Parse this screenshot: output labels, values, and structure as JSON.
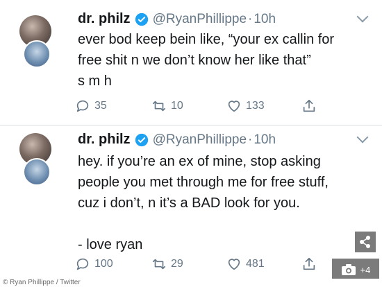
{
  "tweets": [
    {
      "name": "dr. philz",
      "handle": "@RyanPhillippe",
      "separator": "·",
      "time": "10h",
      "lines": [
        "ever bod keep bein like, “your ex callin for",
        "free shit n we don’t know her like that”",
        "s m h"
      ],
      "replies": "35",
      "retweets": "10",
      "likes": "133"
    },
    {
      "name": "dr. philz",
      "handle": "@RyanPhillippe",
      "separator": "·",
      "time": "10h",
      "lines": [
        "hey. if you’re an ex of mine, stop asking",
        "people you met through me for free stuff,",
        "cuz i don’t, n it’s a BAD look for you.",
        "",
        "- love ryan"
      ],
      "replies": "100",
      "retweets": "29",
      "likes": "481"
    }
  ],
  "overlay": {
    "photo_count": "+4",
    "credit": "© Ryan Phillippe / Twitter"
  },
  "colors": {
    "verified": "#1da1f2",
    "muted": "#657786",
    "text": "#14171a",
    "overlay": "#7b7b7b"
  },
  "icons": {
    "verified": "verified-badge-icon",
    "reply": "reply-icon",
    "retweet": "retweet-icon",
    "like": "heart-icon",
    "share": "share-icon",
    "more": "chevron-down-icon",
    "camera": "camera-icon"
  }
}
